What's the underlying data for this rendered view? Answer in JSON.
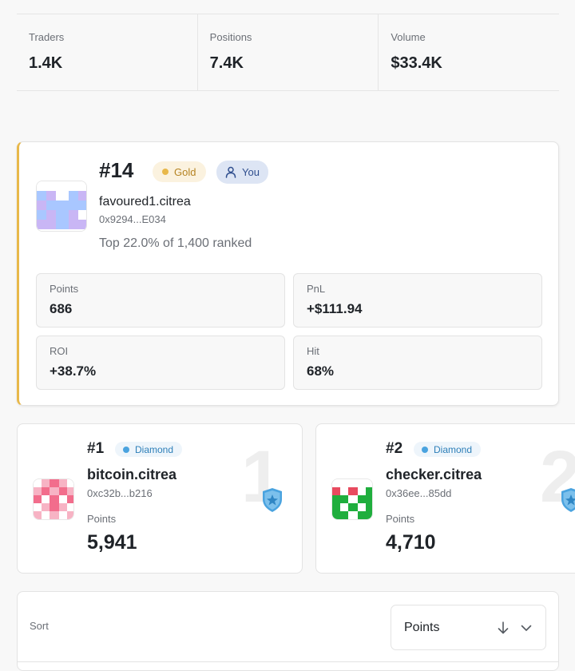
{
  "stats": [
    {
      "label": "Traders",
      "value": "1.4K"
    },
    {
      "label": "Positions",
      "value": "7.4K"
    },
    {
      "label": "Volume",
      "value": "$33.4K"
    }
  ],
  "me": {
    "rank": "#14",
    "tier": "Gold",
    "you_label": "You",
    "name": "favoured1.citrea",
    "address": "0x9294...E034",
    "top_text": "Top 22.0% of 1,400 ranked",
    "metrics": [
      {
        "label": "Points",
        "value": "686"
      },
      {
        "label": "PnL",
        "value": "+$111.94"
      },
      {
        "label": "ROI",
        "value": "+38.7%"
      },
      {
        "label": "Hit",
        "value": "68%"
      }
    ],
    "accent_color": "#e8b84a"
  },
  "leaders": [
    {
      "rank": "#1",
      "big_rank": "1",
      "tier": "Diamond",
      "name": "bitcoin.citrea",
      "address": "0xc32b...b216",
      "points_label": "Points",
      "points": "5,941"
    },
    {
      "rank": "#2",
      "big_rank": "2",
      "tier": "Diamond",
      "name": "checker.citrea",
      "address": "0x36ee...85dd",
      "points_label": "Points",
      "points": "4,710"
    }
  ],
  "sort": {
    "label": "Sort",
    "value": "Points",
    "direction_icon": "arrow-down-icon",
    "dropdown_icon": "chevron-down-icon"
  },
  "colors": {
    "gold": "#e8b84a",
    "diamond": "#4aa3df",
    "you_bg": "#dde5f4"
  }
}
